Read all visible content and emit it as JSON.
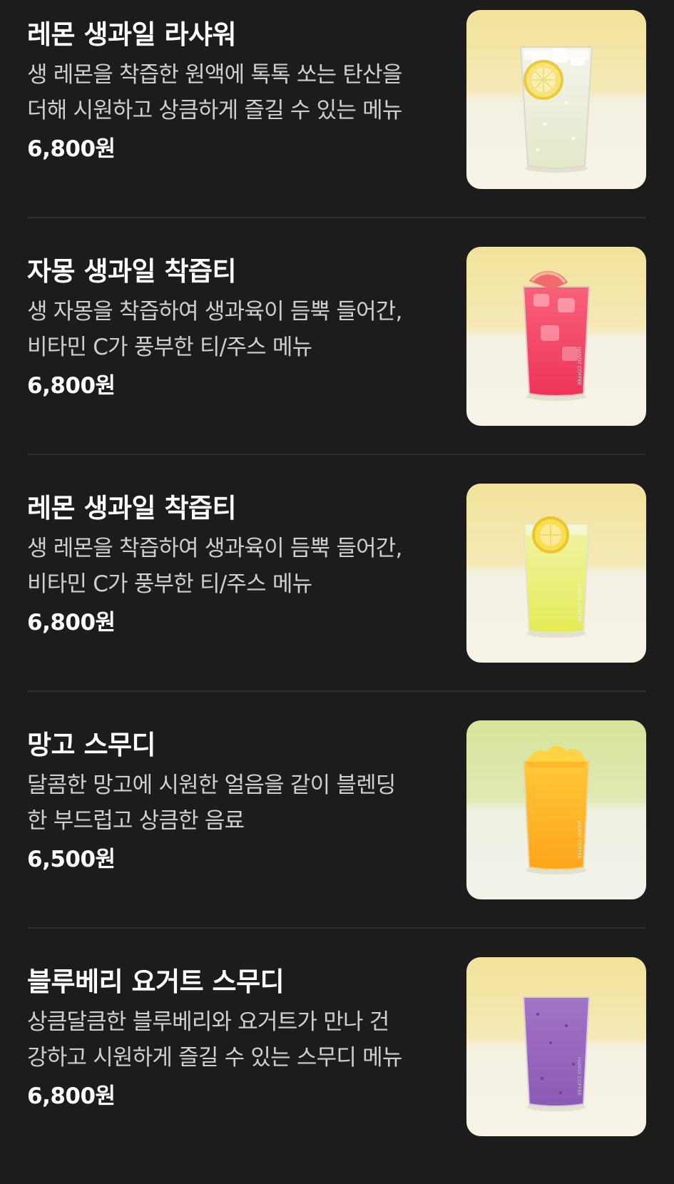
{
  "menu": {
    "items": [
      {
        "name": "레몬 생과일 라샤워",
        "description": "생 레몬을 착즙한 원액에 톡톡 쏘는 탄산을\n더해 시원하고 상큼하게 즐길 수 있는 메뉴",
        "price": "6,800원",
        "image_alt": "레몬 생과일 라샤워 image"
      },
      {
        "name": "자몽 생과일 착즙티",
        "description": "생 자몽을 착즙하여 생과육이 듬뿍 들어간,\n비타민 C가 풍부한 티/주스 메뉴",
        "price": "6,800원",
        "image_alt": "자몽 생과일 착즙티 image"
      },
      {
        "name": "레몬 생과일 착즙티",
        "description": "생 레몬을 착즙하여 생과육이 듬뿍 들어간,\n비타민 C가 풍부한 티/주스 메뉴",
        "price": "6,800원",
        "image_alt": "레몬 생과일 착즙티 image"
      },
      {
        "name": "망고 스무디",
        "description": "달콤한 망고에 시원한 얼음을 같이 블렌딩\n한 부드럽고 상큼한 음료",
        "price": "6,500원",
        "image_alt": "망고 스무디 image"
      },
      {
        "name": "블루베리 요거트 스무디",
        "description": "상큼달큼한 블루베리와 요거트가 만나 건\n강하고 시원하게 즐길 수 있는 스무디 메뉴",
        "price": "6,800원",
        "image_alt": "블루베리 요거트 스무디 image"
      }
    ]
  },
  "colors": {
    "background": "#1c1c1c",
    "divider": "#2f2f2f",
    "text_primary": "#ffffff",
    "text_secondary": "#cfcfcf",
    "thumb_bg_warm": "#f3e39c",
    "thumb_bg_green": "#dde6a2",
    "thumb_floor": "#f3f0e3"
  }
}
